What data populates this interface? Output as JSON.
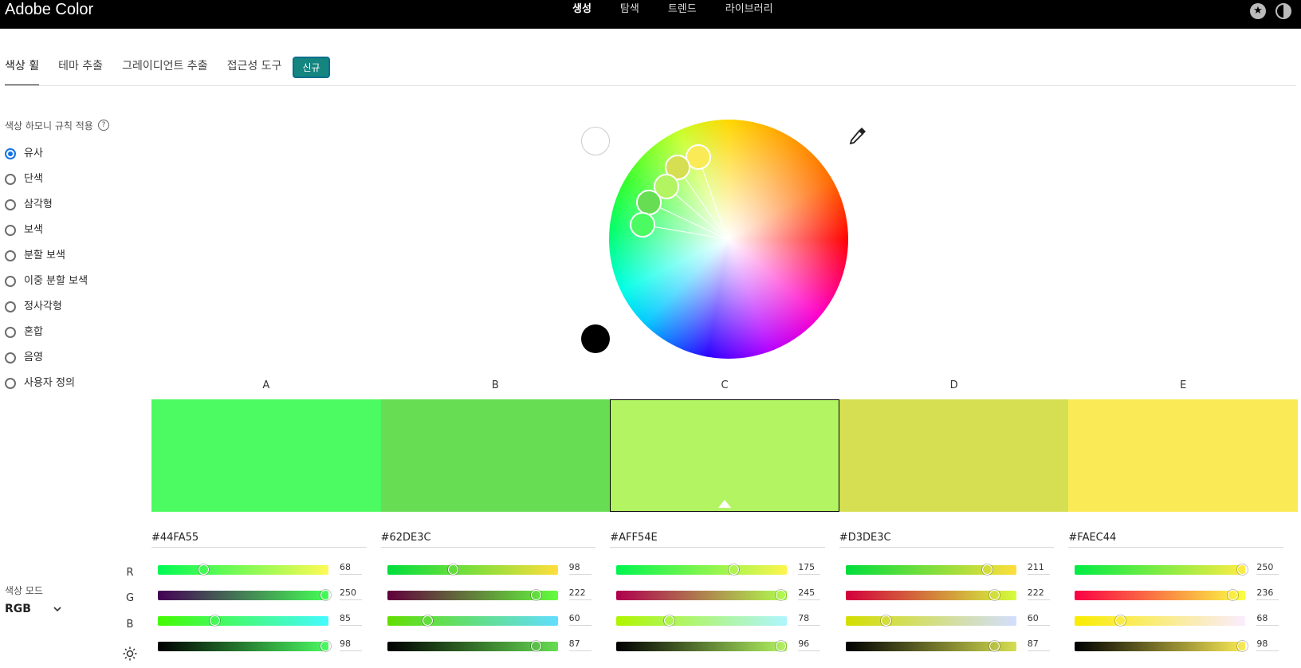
{
  "app": {
    "brand": "Adobe Color"
  },
  "topnav": [
    {
      "label": "생성",
      "active": true
    },
    {
      "label": "탐색",
      "active": false
    },
    {
      "label": "트렌드",
      "active": false
    },
    {
      "label": "라이브러리",
      "active": false
    }
  ],
  "subtabs": [
    {
      "label": "색상 휠",
      "active": true
    },
    {
      "label": "테마 추출",
      "active": false
    },
    {
      "label": "그레이디언트 추출",
      "active": false
    },
    {
      "label": "접근성 도구",
      "active": false
    }
  ],
  "badge": "신규",
  "harmony": {
    "label": "색상 하모니 규칙 적용",
    "options": [
      {
        "label": "유사",
        "checked": true
      },
      {
        "label": "단색",
        "checked": false
      },
      {
        "label": "삼각형",
        "checked": false
      },
      {
        "label": "보색",
        "checked": false
      },
      {
        "label": "분할 보색",
        "checked": false
      },
      {
        "label": "이중 분할 보색",
        "checked": false
      },
      {
        "label": "정사각형",
        "checked": false
      },
      {
        "label": "혼합",
        "checked": false
      },
      {
        "label": "음영",
        "checked": false
      },
      {
        "label": "사용자 정의",
        "checked": false
      }
    ]
  },
  "colorMode": {
    "label": "색상 모드",
    "value": "RGB"
  },
  "rowLabels": [
    "R",
    "G",
    "B"
  ],
  "swatches": [
    {
      "label": "A",
      "hex": "#44FA55",
      "color": "#4cfa62",
      "r": 68,
      "g": 250,
      "b": 85,
      "brightness": 98,
      "selected": false
    },
    {
      "label": "B",
      "hex": "#62DE3C",
      "color": "#66dd52",
      "r": 98,
      "g": 222,
      "b": 60,
      "brightness": 87,
      "selected": false
    },
    {
      "label": "C",
      "hex": "#AFF54E",
      "color": "#b3f462",
      "r": 175,
      "g": 245,
      "b": 78,
      "brightness": 96,
      "selected": true
    },
    {
      "label": "D",
      "hex": "#D3DE3C",
      "color": "#d6de52",
      "r": 211,
      "g": 222,
      "b": 60,
      "brightness": 87,
      "selected": false
    },
    {
      "label": "E",
      "hex": "#FAEC44",
      "color": "#faeb56",
      "r": 250,
      "g": 236,
      "b": 68,
      "brightness": 98,
      "selected": false
    }
  ]
}
